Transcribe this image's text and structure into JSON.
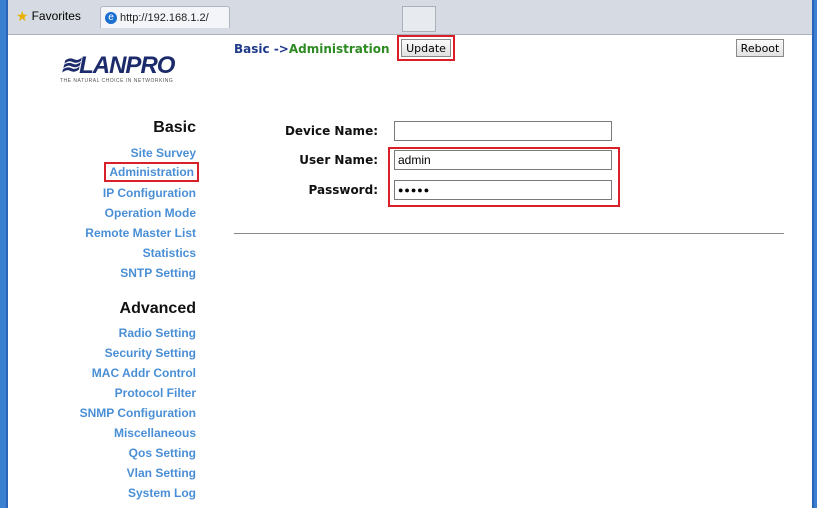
{
  "browser": {
    "favorites_label": "Favorites",
    "tab_url": "http://192.168.1.2/"
  },
  "logo": {
    "main": "≋LANPRO",
    "sub": "THE NATURAL CHOICE IN NETWORKING"
  },
  "sidebar": {
    "basic_title": "Basic",
    "basic_items": [
      "Site Survey",
      "Administration",
      "IP Configuration",
      "Operation Mode",
      "Remote Master List",
      "Statistics",
      "SNTP Setting"
    ],
    "advanced_title": "Advanced",
    "advanced_items": [
      "Radio Setting",
      "Security Setting",
      "MAC Addr Control",
      "Protocol Filter",
      "SNMP Configuration",
      "Miscellaneous",
      "Qos Setting",
      "Vlan Setting",
      "System Log"
    ]
  },
  "header": {
    "crumb_basic": "Basic",
    "crumb_arrow": "->",
    "crumb_admin": "Administration",
    "update_label": "Update",
    "reboot_label": "Reboot"
  },
  "form": {
    "device_name_label": "Device Name:",
    "device_name_value": "",
    "user_name_label": "User Name:",
    "user_name_value": "admin",
    "password_label": "Password:",
    "password_value": "●●●●●"
  },
  "colors": {
    "highlight": "#d81f2a",
    "nav_link": "#4a8fd6",
    "crumb_green": "#2e8b22"
  }
}
